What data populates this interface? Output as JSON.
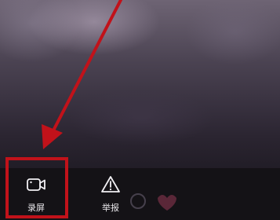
{
  "actions": [
    {
      "label": "录屏",
      "icon": "video-camera-icon"
    },
    {
      "label": "举报",
      "icon": "warning-triangle-icon"
    }
  ],
  "colors": {
    "annotation": "#c1121a",
    "sheet_bg": "#141216",
    "label": "#e8e6ea"
  }
}
